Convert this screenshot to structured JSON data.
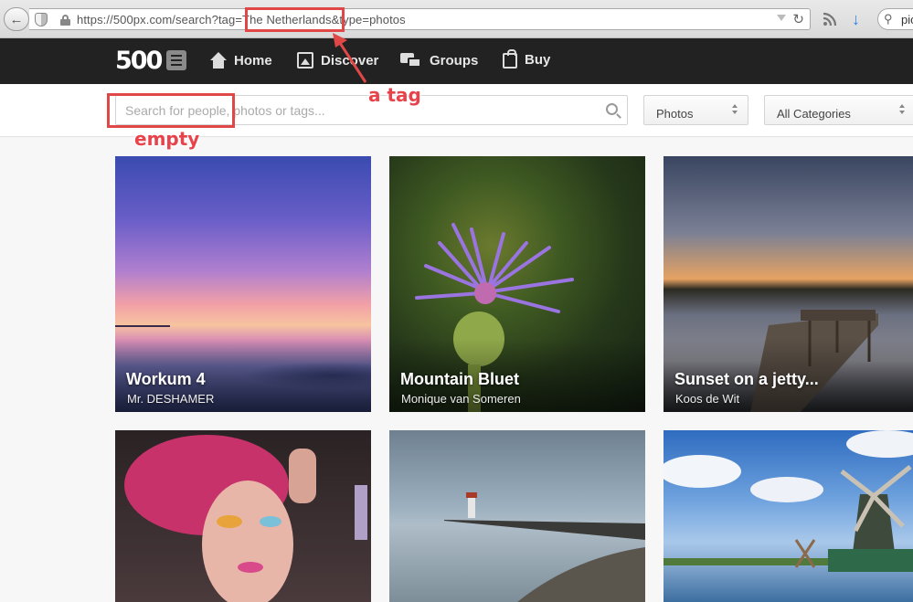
{
  "browser": {
    "url": "https://500px.com/search?tag=The Netherlands&type=photos",
    "search_text": "pic"
  },
  "nav": {
    "logo": "500",
    "items": [
      {
        "label": "Home",
        "icon": "home-icon"
      },
      {
        "label": "Discover",
        "icon": "image-icon"
      },
      {
        "label": "Groups",
        "icon": "chat-icon"
      },
      {
        "label": "Buy",
        "icon": "shopping-bag-icon"
      }
    ]
  },
  "search": {
    "placeholder": "Search for people, photos or tags...",
    "value": "",
    "type_select": "Photos",
    "category_select": "All Categories"
  },
  "photos": [
    {
      "title": "Workum 4",
      "author": "Mr. DESHAMER"
    },
    {
      "title": "Mountain Bluet",
      "author": "Monique van Someren"
    },
    {
      "title": "Sunset on a jetty...",
      "author": "Koos de Wit"
    },
    {
      "title": "",
      "author": ""
    },
    {
      "title": "",
      "author": ""
    },
    {
      "title": "",
      "author": ""
    }
  ],
  "annotations": {
    "tag_label": "a tag",
    "empty_label": "empty",
    "color": "#e04848"
  },
  "colors": {
    "nav_bg": "#222222",
    "page_bg": "#f7f7f7"
  }
}
